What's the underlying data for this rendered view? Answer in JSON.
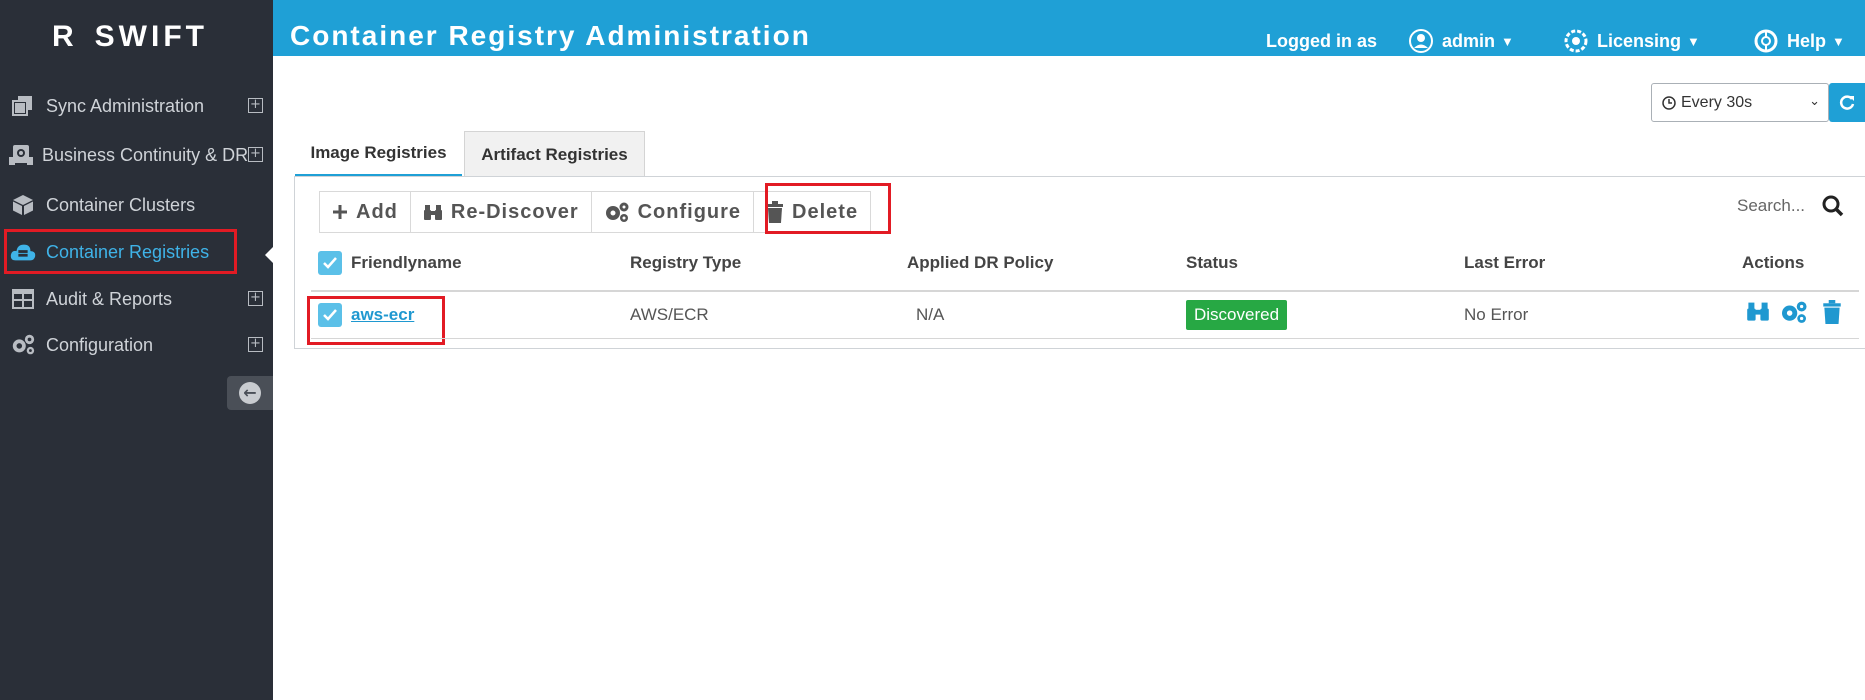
{
  "brand": {
    "mark": "R",
    "name": "SWIFT"
  },
  "sidebar": {
    "items": [
      {
        "label": "Sync Administration",
        "icon": "copy-icon",
        "expandable": true
      },
      {
        "label": "Business Continuity & DR",
        "icon": "bcdr-icon",
        "expandable": true
      },
      {
        "label": "Container Clusters",
        "icon": "cube-icon",
        "expandable": false
      },
      {
        "label": "Container Registries",
        "icon": "cloud-server-icon",
        "expandable": false,
        "active": true
      },
      {
        "label": "Audit & Reports",
        "icon": "table-icon",
        "expandable": true
      },
      {
        "label": "Configuration",
        "icon": "gears-icon",
        "expandable": true
      }
    ]
  },
  "header": {
    "title": "Container Registry Administration",
    "logged_in_label": "Logged in as",
    "user": "admin",
    "licensing": "Licensing",
    "help": "Help"
  },
  "refresh": {
    "selected": "Every 30s"
  },
  "tabs": [
    {
      "label": "Image Registries",
      "active": true
    },
    {
      "label": "Artifact Registries",
      "active": false
    }
  ],
  "toolbar": {
    "add": "Add",
    "rediscover": "Re-Discover",
    "configure": "Configure",
    "delete": "Delete"
  },
  "search": {
    "placeholder": "Search..."
  },
  "table": {
    "columns": [
      "Friendlyname",
      "Registry Type",
      "Applied DR Policy",
      "Status",
      "Last Error",
      "Actions"
    ],
    "rows": [
      {
        "friendlyname": "aws-ecr",
        "registry_type": "AWS/ECR",
        "dr_policy": "N/A",
        "status": "Discovered",
        "last_error": "No Error",
        "selected": true
      }
    ]
  },
  "colors": {
    "header_bg": "#1fa0d6",
    "sidebar_bg": "#2a2f38",
    "active_nav": "#3fb3e8",
    "status_green": "#27a844",
    "highlight_red": "#e21b24"
  }
}
